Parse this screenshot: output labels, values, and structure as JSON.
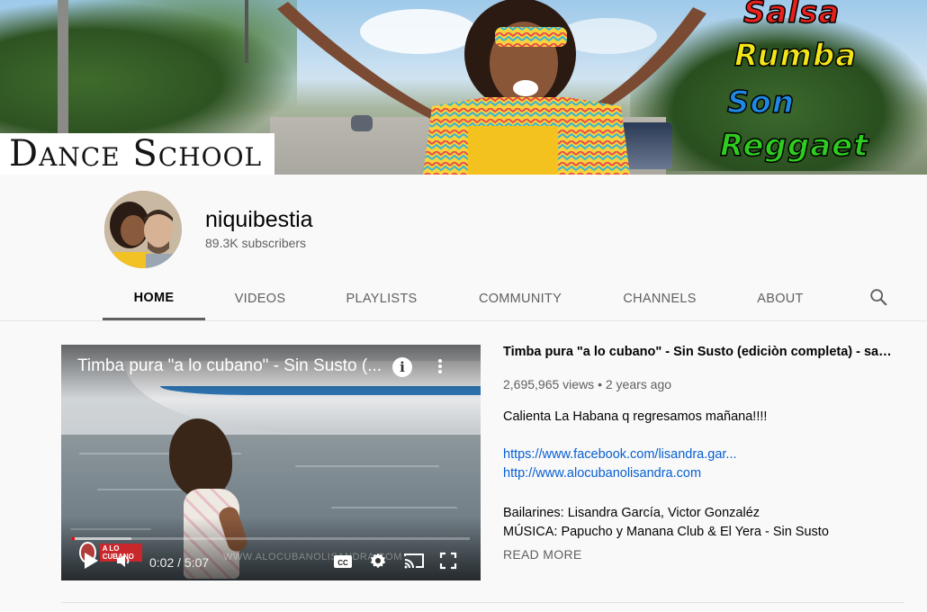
{
  "banner": {
    "dance_school": "Dance School",
    "genres": [
      {
        "text": "Salsa",
        "color": "#e8201c"
      },
      {
        "text": "Rumba",
        "color": "#f2e51a"
      },
      {
        "text": "Son",
        "color": "#1e88e5"
      },
      {
        "text": "Reggaet",
        "color": "#2ecc1f"
      }
    ]
  },
  "channel": {
    "name": "niquibestia",
    "subscribers": "89.3K subscribers",
    "tabs": [
      "HOME",
      "VIDEOS",
      "PLAYLISTS",
      "COMMUNITY",
      "CHANNELS",
      "ABOUT"
    ],
    "active_tab": "HOME",
    "search_icon": "search-icon"
  },
  "player": {
    "title": "Timba pura \"a lo cubano\" - Sin Susto (...",
    "current_time": "0:02",
    "duration": "5:07",
    "time_display": "0:02 / 5:07",
    "progress_played": 0.007,
    "progress_buffered": 0.15,
    "watermark_text": "A LO CUBANO",
    "site_watermark": "WWW.ALOCUBANOLISANDRA.COM",
    "icons": [
      "info-icon",
      "more-vert-icon",
      "play-icon",
      "volume-icon",
      "cc-icon",
      "settings-icon",
      "cast-icon",
      "fullscreen-icon"
    ],
    "accent": "#ff0000"
  },
  "video": {
    "title": "Timba pura \"a lo cubano\" - Sin Susto (ediciòn completa) - sals...",
    "views": "2,695,965 views",
    "separator": "•",
    "age": "2 years ago",
    "description_line1": "Calienta La Habana q regresamos mañana!!!!",
    "link1": "https://www.facebook.com/lisandra.gar...",
    "link2": "http://www.alocubanolisandra.com",
    "dancers": "Bailarines: Lisandra García, Victor Gonzaléz",
    "music": "MÚSICA: Papucho y Manana Club & El Yera - Sin Susto",
    "read_more": "READ MORE",
    "link_color": "#065fd4"
  }
}
